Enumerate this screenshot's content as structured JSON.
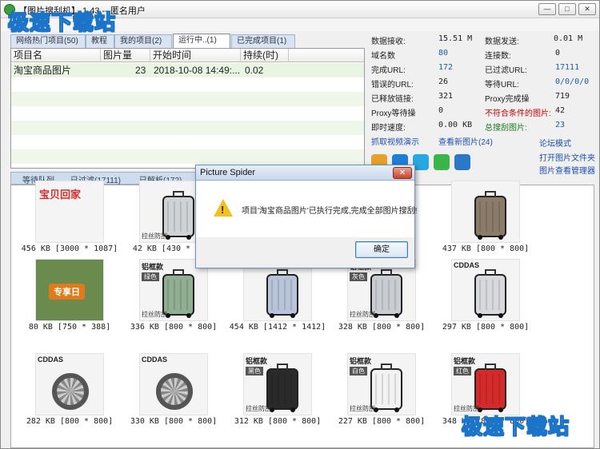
{
  "window": {
    "title": "【图片搜刮机】 1.43 -- 匿名用户",
    "buttons": {
      "minimize": "—",
      "maximize": "□",
      "close": "✕"
    }
  },
  "watermark": "极速下载站",
  "menu": {
    "items": [
      "项",
      "目"
    ]
  },
  "tabs_top": [
    "网络热门项目(50)",
    "教程",
    "我的项目(2)",
    "运行中..(1)",
    "已完成项目(1)"
  ],
  "task_table": {
    "columns": [
      "项目名",
      "图片量",
      "开始时间",
      "持续(时)"
    ],
    "rows": [
      {
        "name": "淘宝商品图片",
        "count": "23",
        "start": "2018-10-08 14:49:...",
        "duration": "0.02"
      }
    ]
  },
  "stats": {
    "data_received_label": "数据接收:",
    "data_received": "15.51 M",
    "data_sent_label": "数据发送:",
    "data_sent": "0.01 M",
    "domains_label": "域名数",
    "domains": "80",
    "connections_label": "连接数:",
    "connections": "0",
    "done_url_label": "完成URL:",
    "done_url": "172",
    "filtered_url_label": "已过滤URL:",
    "filtered_url": "17111",
    "error_url_label": "错误的URL:",
    "error_url": "26",
    "waiting_label": "等待URL:",
    "waiting": "0/0/0/0",
    "released_label": "已释放链接:",
    "released": "321",
    "proxy_done_label": "Proxy完成操",
    "proxy_done": "719",
    "proxy_wait_label": "Proxy等待操",
    "proxy_wait": "0",
    "nonmatch_label": "不符合条件的图片:",
    "nonmatch": "42",
    "speed_label": "即时速度:",
    "speed": "0.00 KB",
    "total_label": "总搜刮图片:",
    "total": "23"
  },
  "links": {
    "video": "抓取视频演示",
    "new_images": "查看新图片(24)",
    "forum": "论坛模式",
    "open_folder": "打开图片文件夹",
    "image_manager": "图片查看管理器"
  },
  "icon_colors": [
    "#e6a12a",
    "#1d7fd6",
    "#25a9e0",
    "#3ab54a",
    "#2a79c9"
  ],
  "tabs_bottom": [
    "等待队列",
    "已过滤(17111)",
    "已解析(172)"
  ],
  "gallery": [
    {
      "caption": "456 KB [3000 * 1087]",
      "kind": "logo",
      "logo_text": "宝贝回家"
    },
    {
      "caption": "42 KB [430 * 430]",
      "kind": "suit",
      "color": "#cfd3d6",
      "label": "拉丝防刮"
    },
    {
      "caption": "",
      "kind": "hidden"
    },
    {
      "caption": "",
      "kind": "hidden"
    },
    {
      "caption": "437 KB [800 * 800]",
      "kind": "photo",
      "color": "#8a7c68"
    },
    {
      "caption": "80 KB [750 * 388]",
      "kind": "banner",
      "banner_text": "专享日"
    },
    {
      "caption": "336 KB [800 * 800]",
      "kind": "suit",
      "color": "#8fae92",
      "tag": "绿色",
      "top": "铝框款",
      "label": "拉丝防刮"
    },
    {
      "caption": "454 KB [1412 * 1412]",
      "kind": "suit",
      "color": "#b7c3d9"
    },
    {
      "caption": "328 KB [800 * 800]",
      "kind": "suit",
      "color": "#c9cdd1",
      "tag": "灰色",
      "top": "铝框款",
      "label": "拉丝防刮"
    },
    {
      "caption": "297 KB [800 * 800]",
      "kind": "suit",
      "color": "#d7d9dc",
      "top": "CDDAS"
    },
    {
      "caption": "282 KB [800 * 800]",
      "kind": "detail",
      "top": "CDDAS"
    },
    {
      "caption": "330 KB [800 * 800]",
      "kind": "detail",
      "top": "CDDAS"
    },
    {
      "caption": "312 KB [800 * 800]",
      "kind": "suit",
      "color": "#2a2a2a",
      "tag": "黑色",
      "top": "铝框款",
      "label": "拉丝防刮"
    },
    {
      "caption": "227 KB [800 * 800]",
      "kind": "suit",
      "color": "#f2f2f2",
      "tag": "白色",
      "top": "铝框款",
      "label": "拉丝防刮"
    },
    {
      "caption": "348 KB [800 * 800]",
      "kind": "suit",
      "color": "#d42a2a",
      "tag": "红色",
      "top": "铝框款",
      "label": "拉丝防刮"
    }
  ],
  "dialog": {
    "title": "Picture Spider",
    "message": "项目'淘宝商品图片'已执行完成,完成全部图片搜刮!",
    "ok": "确定",
    "close": "✕"
  }
}
